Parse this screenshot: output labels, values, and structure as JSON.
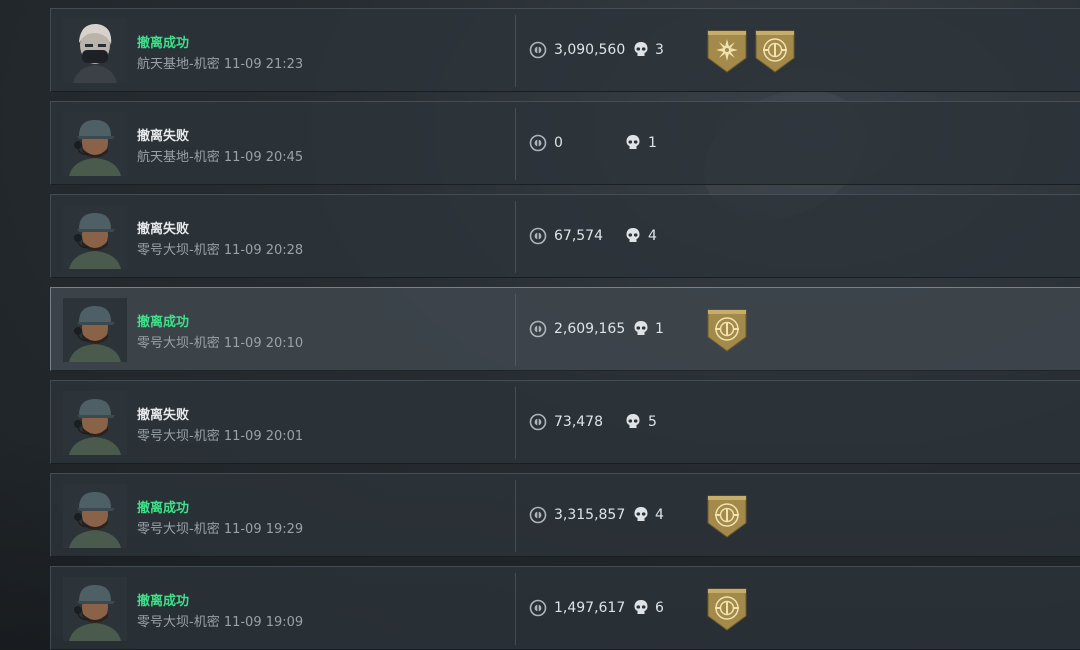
{
  "colors": {
    "success": "#3fe08a",
    "fail": "#e6e8ea",
    "badge_gold": "#a3894a"
  },
  "records": [
    {
      "status": "撤离成功",
      "result": "success",
      "info": "航天基地-机密 11-09 21:23",
      "money": "3,090,560",
      "kills": "3",
      "avatar": "female-operator-avatar",
      "badges": [
        "sun-emblem-badge",
        "crest-emblem-badge"
      ]
    },
    {
      "status": "撤离失败",
      "result": "fail",
      "info": "航天基地-机密 11-09 20:45",
      "money": "0",
      "kills": "1",
      "avatar": "soldier-cap-avatar",
      "badges": []
    },
    {
      "status": "撤离失败",
      "result": "fail",
      "info": "零号大坝-机密 11-09 20:28",
      "money": "67,574",
      "kills": "4",
      "avatar": "soldier-cap-avatar",
      "badges": []
    },
    {
      "status": "撤离成功",
      "result": "success",
      "info": "零号大坝-机密 11-09 20:10",
      "money": "2,609,165",
      "kills": "1",
      "avatar": "soldier-cap-avatar",
      "badges": [
        "crest-emblem-badge"
      ]
    },
    {
      "status": "撤离失败",
      "result": "fail",
      "info": "零号大坝-机密 11-09 20:01",
      "money": "73,478",
      "kills": "5",
      "avatar": "soldier-cap-avatar",
      "badges": []
    },
    {
      "status": "撤离成功",
      "result": "success",
      "info": "零号大坝-机密 11-09 19:29",
      "money": "3,315,857",
      "kills": "4",
      "avatar": "soldier-cap-avatar",
      "badges": [
        "crest-emblem-badge"
      ]
    },
    {
      "status": "撤离成功",
      "result": "success",
      "info": "零号大坝-机密 11-09 19:09",
      "money": "1,497,617",
      "kills": "6",
      "avatar": "soldier-cap-avatar",
      "badges": [
        "crest-emblem-badge"
      ]
    }
  ]
}
